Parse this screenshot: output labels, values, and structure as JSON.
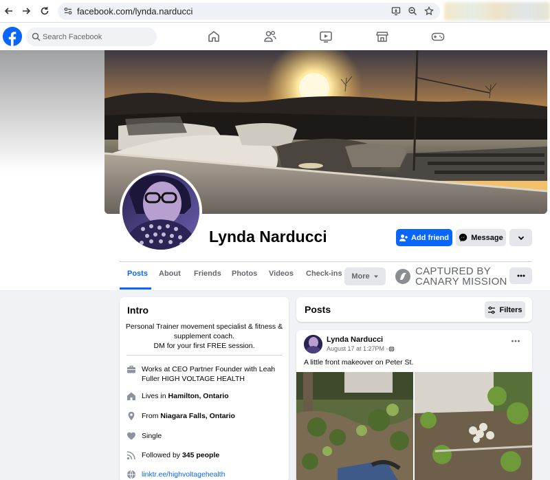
{
  "browser": {
    "url": "facebook.com/lynda.narducci"
  },
  "search": {
    "placeholder": "Search Facebook"
  },
  "profile": {
    "name": "Lynda Narducci",
    "add_friend_label": "Add friend",
    "message_label": "Message"
  },
  "tabs": [
    {
      "label": "Posts",
      "active": true
    },
    {
      "label": "About"
    },
    {
      "label": "Friends"
    },
    {
      "label": "Photos"
    },
    {
      "label": "Videos"
    },
    {
      "label": "Check-ins"
    },
    {
      "label": "More"
    }
  ],
  "watermark": {
    "line1": "CAPTURED BY",
    "line2": "CANARY MISSION"
  },
  "intro": {
    "title": "Intro",
    "bio_line1": "Personal Trainer movement specialist & fitness &",
    "bio_line2": "supplement coach.",
    "bio_line3": "DM for your first FREE session.",
    "work_line1": "Works at CEO Partner Founder with Leah",
    "work_line2": "Fuller HIGH VOLTAGE HEALTH",
    "lives_prefix": "Lives in ",
    "lives_city": "Hamilton, Ontario",
    "from_prefix": "From ",
    "from_city": "Niagara Falls, Ontario",
    "relationship": "Single",
    "followed_prefix": "Followed by ",
    "followed_count": "345 people",
    "link": "linktr.ee/highvoltagehealth"
  },
  "posts": {
    "title": "Posts",
    "filters_label": "Filters",
    "post": {
      "author": "Lynda Narducci",
      "date": "August 17 at 1:27PM · ",
      "text": "A little front makeover on Peter St."
    }
  },
  "colors": {
    "brand": "#0866ff",
    "page_bg": "#f0f2f5",
    "secondary_button": "#e4e6eb"
  }
}
